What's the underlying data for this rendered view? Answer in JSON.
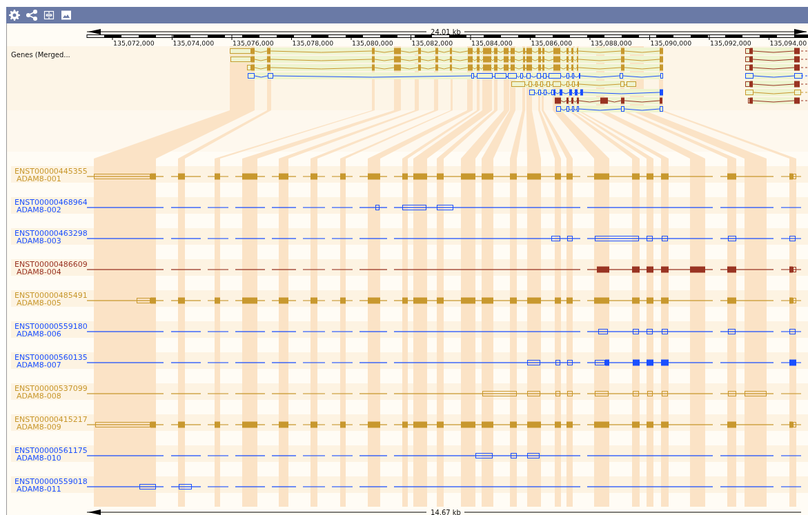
{
  "scale_top": {
    "label": "24.01 kb"
  },
  "ruler": {
    "ticks": [
      "135,072,000",
      "135,074,000",
      "135,076,000",
      "135,078,000",
      "135,080,000",
      "135,082,000",
      "135,084,000",
      "135,086,000",
      "135,088,000",
      "135,090,000",
      "135,092,000",
      "135,094,00"
    ]
  },
  "gene_track": {
    "label": "Genes (Merged..."
  },
  "transcripts": [
    {
      "id": "ENST00000445355",
      "name": "ADAM8-001",
      "color": "#c8982e"
    },
    {
      "id": "ENST00000468964",
      "name": "ADAM8-002",
      "color": "#1a4fff"
    },
    {
      "id": "ENST00000463298",
      "name": "ADAM8-003",
      "color": "#1a4fff"
    },
    {
      "id": "ENST00000486609",
      "name": "ADAM8-004",
      "color": "#993322"
    },
    {
      "id": "ENST00000485491",
      "name": "ADAM8-005",
      "color": "#c8982e"
    },
    {
      "id": "ENST00000559180",
      "name": "ADAM8-006",
      "color": "#1a4fff"
    },
    {
      "id": "ENST00000560135",
      "name": "ADAM8-007",
      "color": "#1a4fff"
    },
    {
      "id": "ENST00000537099",
      "name": "ADAM8-008",
      "color": "#c8982e"
    },
    {
      "id": "ENST00000415217",
      "name": "ADAM8-009",
      "color": "#c8982e"
    },
    {
      "id": "ENST00000561175",
      "name": "ADAM8-010",
      "color": "#1a4fff"
    },
    {
      "id": "ENST00000559018",
      "name": "ADAM8-011",
      "color": "#1a4fff"
    }
  ],
  "scale_bottom": {
    "label": "14.67 kb"
  }
}
